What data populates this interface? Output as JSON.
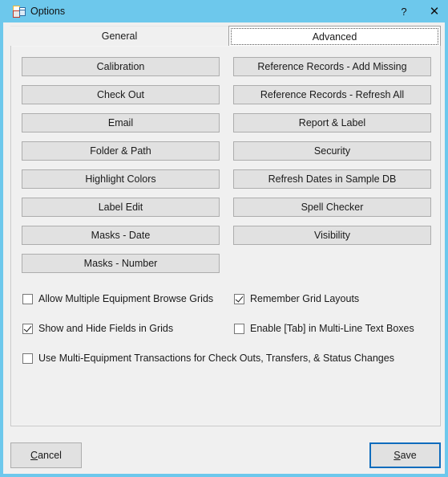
{
  "window": {
    "title": "Options",
    "icon": "winforms-options-icon",
    "accent_color": "#6DC8EC",
    "body_color": "#f0f0f0",
    "focus_color": "#0f6cbd",
    "caption_buttons": [
      {
        "name": "help",
        "glyph": "?"
      },
      {
        "name": "close",
        "glyph": "✕"
      }
    ]
  },
  "tabs": [
    {
      "label": "General",
      "selected": false
    },
    {
      "label": "Advanced",
      "selected": true
    }
  ],
  "buttons": {
    "left_column": [
      {
        "label": "Calibration"
      },
      {
        "label": "Check Out"
      },
      {
        "label": "Email"
      },
      {
        "label": "Folder & Path"
      },
      {
        "label": "Highlight Colors"
      },
      {
        "label": "Label Edit"
      },
      {
        "label": "Masks - Date"
      },
      {
        "label": "Masks - Number"
      }
    ],
    "right_column": [
      {
        "label": "Reference Records - Add Missing"
      },
      {
        "label": "Reference Records - Refresh All"
      },
      {
        "label": "Report & Label"
      },
      {
        "label": "Security"
      },
      {
        "label": "Refresh Dates in Sample DB"
      },
      {
        "label": "Spell Checker"
      },
      {
        "label": "Visibility"
      }
    ]
  },
  "checkboxes": [
    {
      "label": "Allow Multiple Equipment Browse Grids",
      "checked": false
    },
    {
      "label": "Remember Grid Layouts",
      "checked": true
    },
    {
      "label": "Show and Hide Fields in Grids",
      "checked": true
    },
    {
      "label": "Enable [Tab] in Multi-Line Text Boxes",
      "checked": false
    },
    {
      "label": "Use Multi-Equipment Transactions for Check Outs, Transfers, & Status Changes",
      "checked": false
    }
  ],
  "footer": {
    "cancel": {
      "accel": "C",
      "rest": "ancel"
    },
    "save": {
      "accel": "S",
      "rest": "ave"
    }
  }
}
